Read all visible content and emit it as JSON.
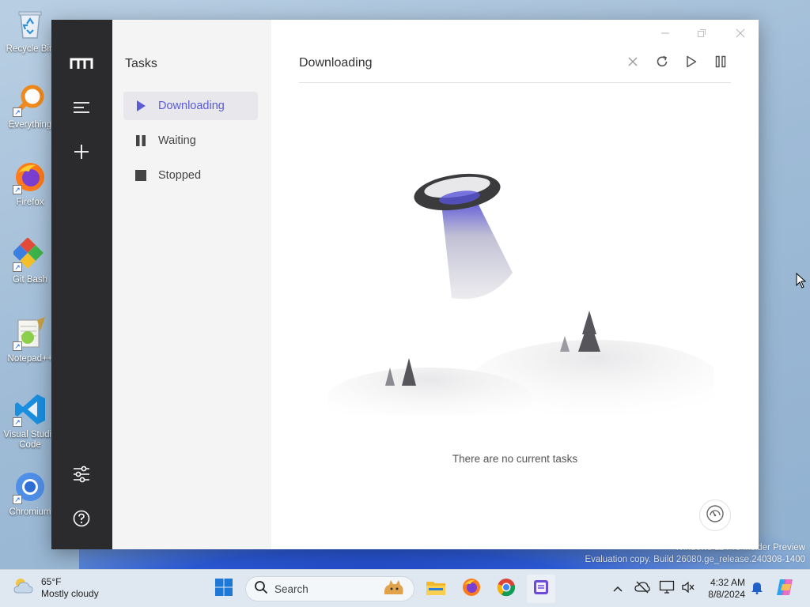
{
  "desktop": {
    "icons": [
      {
        "label": "Recycle Bin",
        "icon": "recycle-bin-icon"
      },
      {
        "label": "Everything",
        "icon": "everything-search-icon"
      },
      {
        "label": "Firefox",
        "icon": "firefox-icon"
      },
      {
        "label": "Git Bash",
        "icon": "git-bash-icon"
      },
      {
        "label": "Notepad++",
        "icon": "notepad-plus-plus-icon"
      },
      {
        "label": "Visual Studio Code",
        "icon": "vscode-icon"
      },
      {
        "label": "Chromium",
        "icon": "chromium-icon"
      }
    ],
    "watermark": {
      "line1": "Windows 11 Pro Insider Preview",
      "line2": "Evaluation copy. Build 26080.ge_release.240308-1400"
    }
  },
  "app": {
    "rail": {
      "logo_icon": "motrix-logo-icon",
      "buttons": [
        "menu-icon",
        "add-task-icon",
        "preferences-icon",
        "help-icon"
      ]
    },
    "sidebar": {
      "title": "Tasks",
      "items": [
        {
          "label": "Downloading",
          "icon": "play-icon",
          "active": true
        },
        {
          "label": "Waiting",
          "icon": "pause-icon",
          "active": false
        },
        {
          "label": "Stopped",
          "icon": "stop-icon",
          "active": false
        }
      ]
    },
    "main": {
      "title": "Downloading",
      "toolbar": [
        "delete-icon",
        "refresh-icon",
        "resume-all-icon",
        "pause-all-icon"
      ],
      "empty_text": "There are no current tasks"
    },
    "colors": {
      "accent": "#5b5bd6",
      "rail": "#2b2b2d",
      "sidebar": "#f4f4f5"
    }
  },
  "taskbar": {
    "weather": {
      "temp": "65°F",
      "condition": "Mostly cloudy"
    },
    "search_label": "Search",
    "pinned": [
      "start-icon",
      "file-explorer-icon",
      "firefox-icon",
      "chrome-icon",
      "motrix-app-icon"
    ],
    "clock": {
      "time": "4:32 AM",
      "date": "8/8/2024"
    }
  }
}
